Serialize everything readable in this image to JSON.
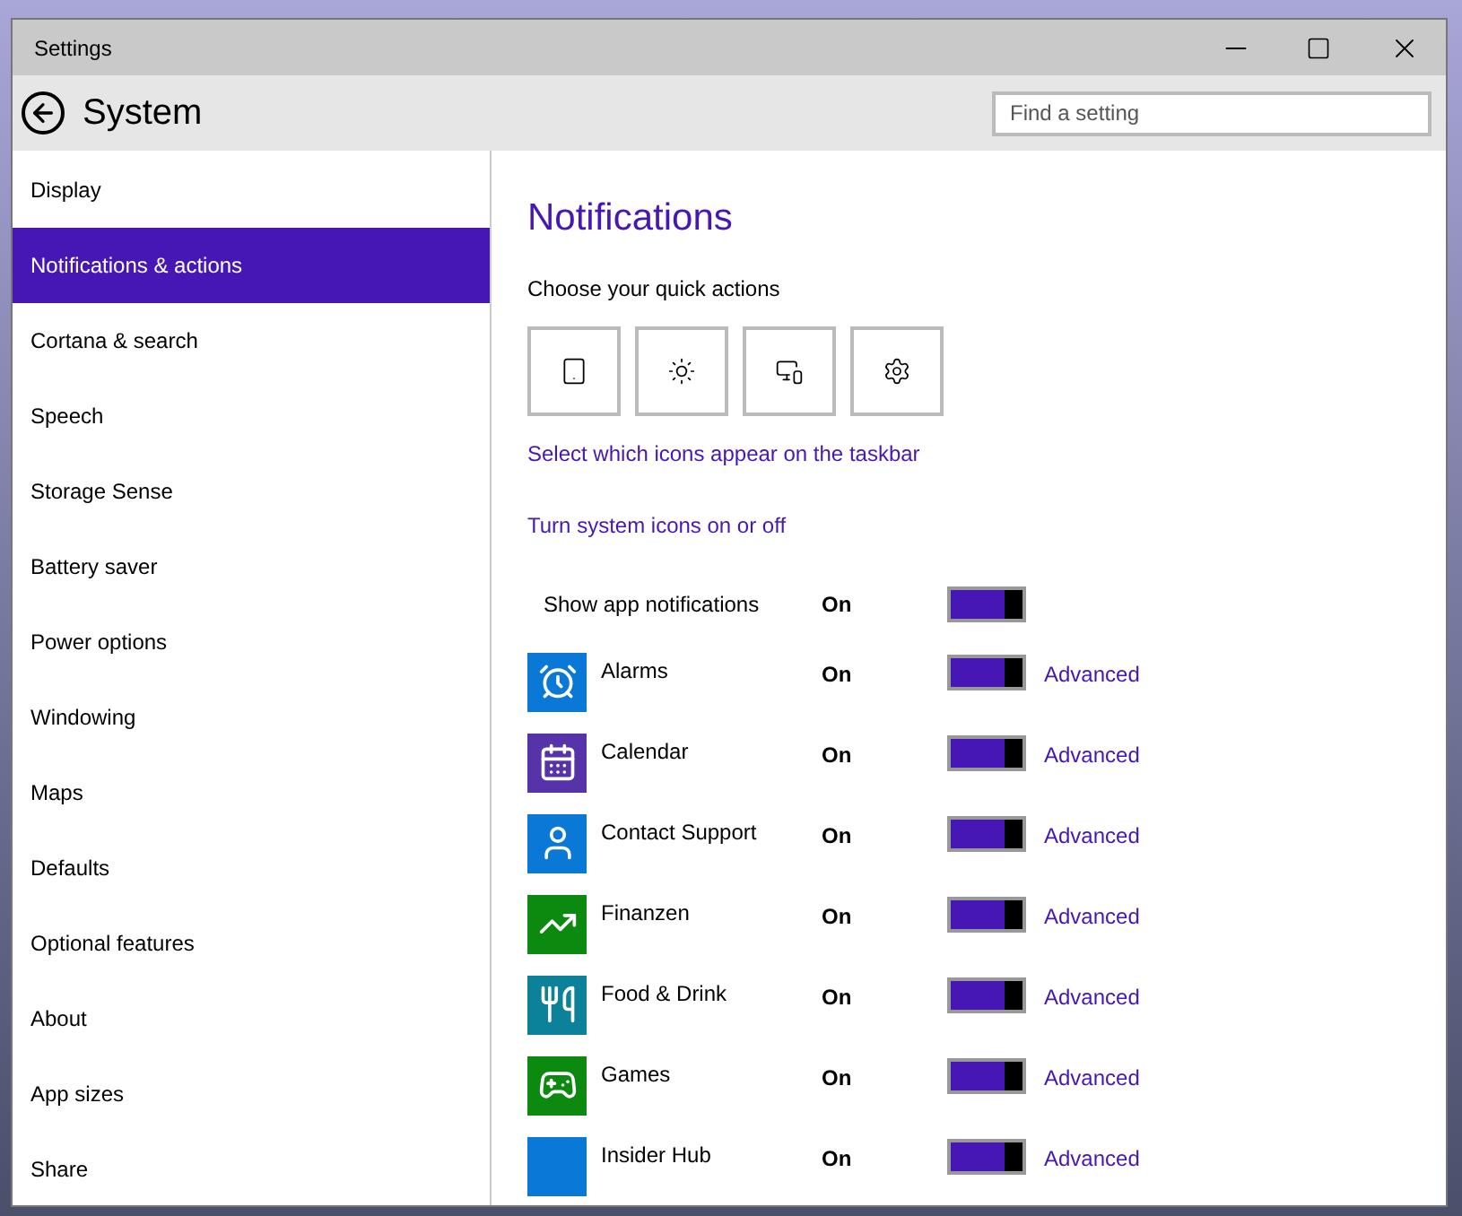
{
  "window": {
    "title": "Settings"
  },
  "header": {
    "title": "System",
    "search": {
      "placeholder": "Find a setting"
    }
  },
  "sidebar": {
    "items": [
      {
        "label": "Display",
        "selected": false
      },
      {
        "label": "Notifications & actions",
        "selected": true
      },
      {
        "label": "Cortana & search",
        "selected": false
      },
      {
        "label": "Speech",
        "selected": false
      },
      {
        "label": "Storage Sense",
        "selected": false
      },
      {
        "label": "Battery saver",
        "selected": false
      },
      {
        "label": "Power options",
        "selected": false
      },
      {
        "label": "Windowing",
        "selected": false
      },
      {
        "label": "Maps",
        "selected": false
      },
      {
        "label": "Defaults",
        "selected": false
      },
      {
        "label": "Optional features",
        "selected": false
      },
      {
        "label": "About",
        "selected": false
      },
      {
        "label": "App sizes",
        "selected": false
      },
      {
        "label": "Share",
        "selected": false
      }
    ]
  },
  "content": {
    "title": "Notifications",
    "quick_actions_label": "Choose your quick actions",
    "quick_actions": [
      {
        "kind": "tablet"
      },
      {
        "kind": "brightness"
      },
      {
        "kind": "project"
      },
      {
        "kind": "settings"
      }
    ],
    "links": [
      "Select which icons appear on the taskbar",
      "Turn system icons on or off"
    ],
    "show_app_notifications": {
      "label": "Show app notifications",
      "state": "On",
      "on": true
    },
    "apps": [
      {
        "name": "Alarms",
        "kind": "alarm",
        "color": "#0a78d7",
        "state": "On",
        "on": true,
        "link": "Advanced"
      },
      {
        "name": "Calendar",
        "kind": "calendar",
        "color": "#5633a8",
        "state": "On",
        "on": true,
        "link": "Advanced"
      },
      {
        "name": "Contact Support",
        "kind": "person",
        "color": "#0a78d7",
        "state": "On",
        "on": true,
        "link": "Advanced"
      },
      {
        "name": "Finanzen",
        "kind": "chart",
        "color": "#0c8a10",
        "state": "On",
        "on": true,
        "link": "Advanced"
      },
      {
        "name": "Food & Drink",
        "kind": "food",
        "color": "#0b829a",
        "state": "On",
        "on": true,
        "link": "Advanced"
      },
      {
        "name": "Games",
        "kind": "games",
        "color": "#0c8a10",
        "state": "On",
        "on": true,
        "link": "Advanced"
      },
      {
        "name": "Insider Hub",
        "kind": "plain",
        "color": "#0a78d7",
        "state": "On",
        "on": true,
        "link": "Advanced"
      }
    ]
  }
}
